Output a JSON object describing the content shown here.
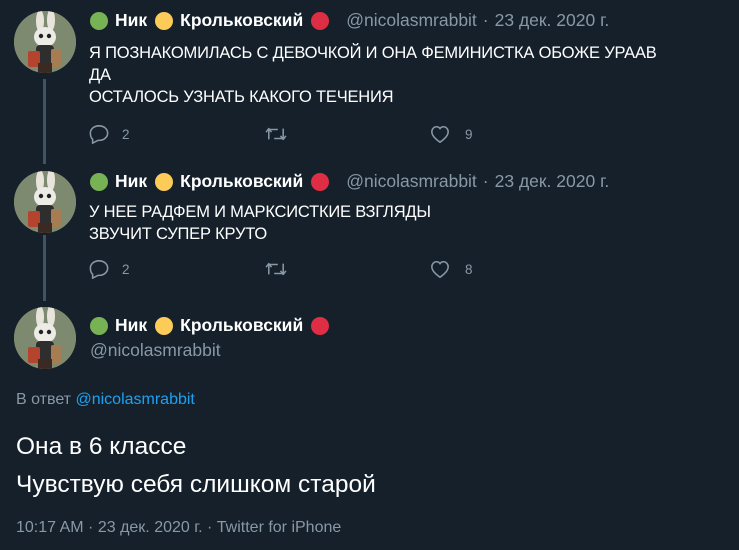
{
  "tweets": [
    {
      "name_part1": "Ник",
      "name_part2": "Крольковский",
      "handle": "@nicolasmrabbit",
      "date": "23 дек. 2020 г.",
      "text": "Я ПОЗНАКОМИЛАСЬ С ДЕВОЧКОЙ И ОНА ФЕМИНИСТКА ОБОЖЕ  УРААВ\nДА\nОСТАЛОСЬ УЗНАТЬ КАКОГО ТЕЧЕНИЯ",
      "replies": "2",
      "likes": "9"
    },
    {
      "name_part1": "Ник",
      "name_part2": "Крольковский",
      "handle": "@nicolasmrabbit",
      "date": "23 дек. 2020 г.",
      "text": "У НЕЕ РАДФЕМ И МАРКСИСТКИЕ ВЗГЛЯДЫ\nЗВУЧИТ СУПЕР КРУТО",
      "replies": "2",
      "likes": "8"
    }
  ],
  "main": {
    "name_part1": "Ник",
    "name_part2": "Крольковский",
    "handle": "@nicolasmrabbit",
    "reply_prefix": "В ответ",
    "reply_mention": "@nicolasmrabbit",
    "text": "Она в 6 классе\nЧувствую себя слишком старой",
    "meta": "10:17 AM · 23 дек. 2020 г. · Twitter for iPhone"
  },
  "colors": {
    "background": "#15202b",
    "muted": "#8899a6",
    "link": "#1da1f2",
    "dot_green": "#77b255",
    "dot_yellow": "#fdcb58",
    "dot_red": "#dd2e44"
  },
  "icons": [
    "reply-icon",
    "retweet-icon",
    "like-icon",
    "avatar-rabbit"
  ]
}
